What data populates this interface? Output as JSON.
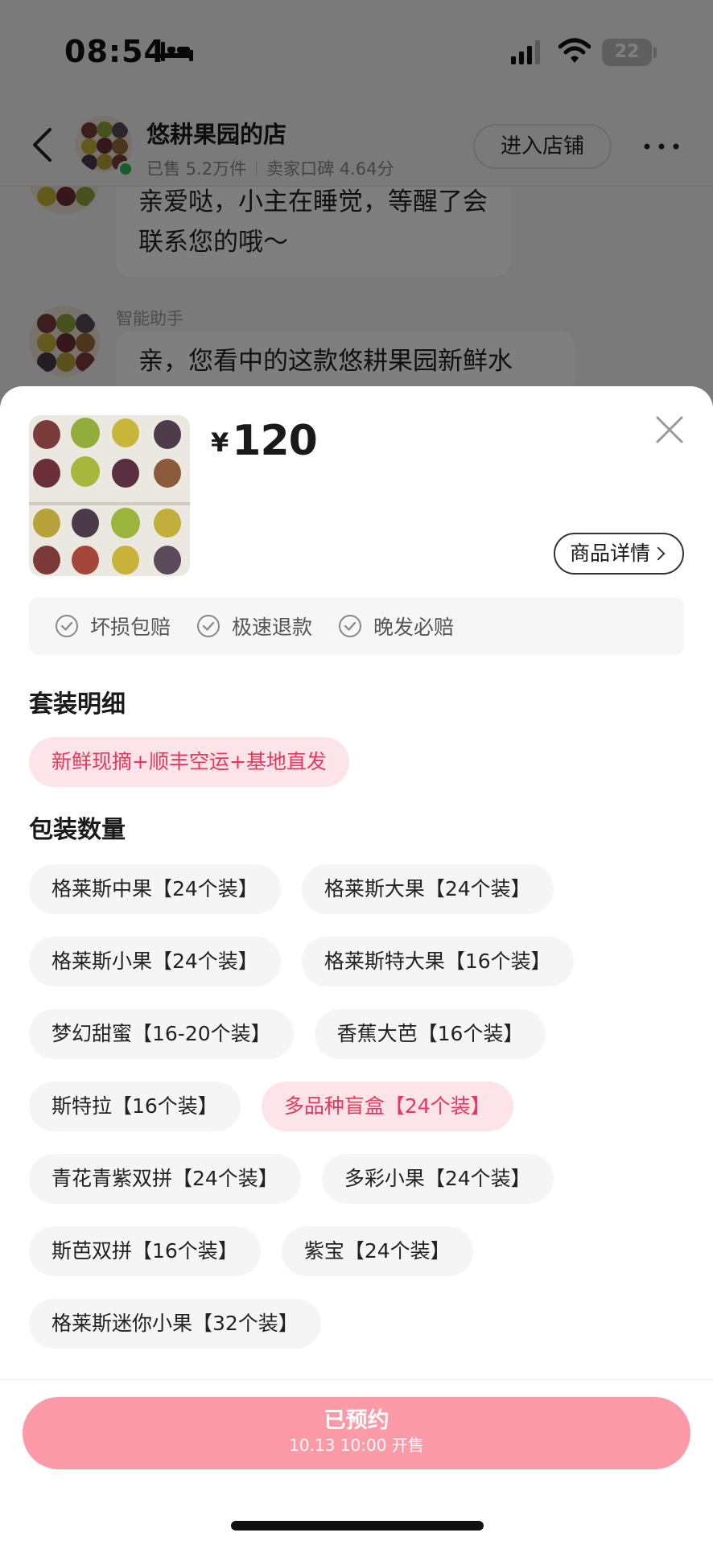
{
  "status_bar": {
    "time": "08:54",
    "battery": "22",
    "icons": [
      "bed-icon",
      "signal-icon",
      "wifi-icon",
      "battery-icon"
    ]
  },
  "header": {
    "shop_name": "悠耕果园的店",
    "sold": "已售 5.2万件",
    "rating": "卖家口碑 4.64分",
    "enter_shop": "进入店铺",
    "icons": [
      "back-icon",
      "more-icon"
    ]
  },
  "chat": {
    "messages": [
      {
        "text_line1": "亲爱哒，小主在睡觉，等醒了会",
        "text_line2": "联系您的哦～"
      },
      {
        "sender": "智能助手",
        "text_line1": "亲，您看中的这款悠耕果园新鲜水"
      }
    ]
  },
  "product": {
    "currency": "¥",
    "price": "120",
    "detail_button": "商品详情",
    "close_icon": "close-icon"
  },
  "guarantees": [
    "坏损包赔",
    "极速退款",
    "晚发必赔"
  ],
  "package_detail": {
    "title": "套装明细",
    "option": "新鲜现摘+顺丰空运+基地直发"
  },
  "quantity": {
    "title": "包装数量",
    "rows": [
      [
        "格莱斯中果【24个装】",
        "格莱斯大果【24个装】"
      ],
      [
        "格莱斯小果【24个装】",
        "格莱斯特大果【16个装】"
      ],
      [
        "梦幻甜蜜【16-20个装】",
        "香蕉大芭【16个装】"
      ],
      [
        "斯特拉【16个装】",
        "多品种盲盒【24个装】"
      ],
      [
        "青花青紫双拼【24个装】",
        "多彩小果【24个装】"
      ],
      [
        "斯芭双拼【16个装】",
        "紫宝【24个装】"
      ],
      [
        "格莱斯迷你小果【32个装】"
      ]
    ],
    "selected": "多品种盲盒【24个装】"
  },
  "footer": {
    "button_main": "已预约",
    "button_sub": "10.13 10:00 开售"
  },
  "colors": {
    "accent_pink": "#e8375c",
    "chip_selected_bg": "#fde4e8",
    "reserve_button": "#fd9aa8",
    "online_dot": "#2dbb55"
  }
}
